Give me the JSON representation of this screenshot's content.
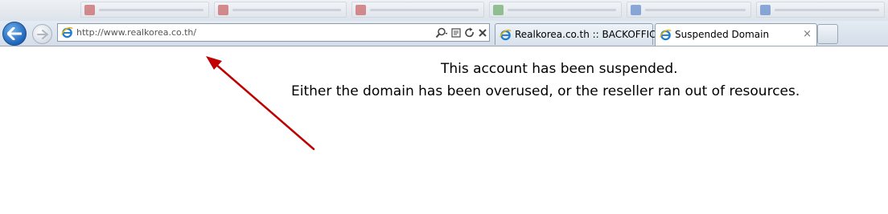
{
  "browser": {
    "address": {
      "url": "http://www.realkorea.co.th/"
    },
    "tabs": [
      {
        "label": "Realkorea.co.th :: BACKOFFICE",
        "active": false
      },
      {
        "label": "Suspended Domain",
        "active": true,
        "close_symbol": "×"
      }
    ]
  },
  "page": {
    "message_line_1": "This account has been suspended.",
    "message_line_2": "Either the domain has been overused, or the reseller ran out of resources."
  },
  "annotation": {
    "arrow_color": "#c00000"
  },
  "icons": [
    "back-arrow-icon",
    "forward-arrow-icon",
    "ie-page-icon",
    "search-icon",
    "compatibility-view-icon",
    "refresh-icon",
    "stop-icon"
  ]
}
